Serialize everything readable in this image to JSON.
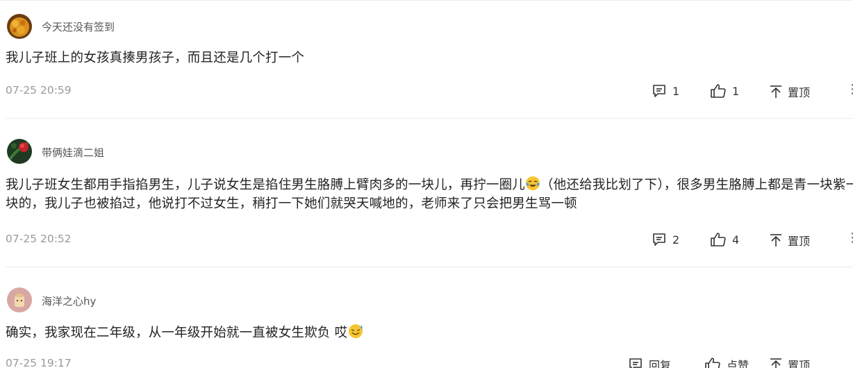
{
  "comments": [
    {
      "username": "今天还没有签到",
      "text": "我儿子班上的女孩真揍男孩子，而且还是几个打一个",
      "timestamp": "07-25 20:59",
      "reply_count": "1",
      "like_count": "1",
      "pin_label": "置顶",
      "avatar_icon": "food-avatar-icon"
    },
    {
      "username": "带俩娃滴二姐",
      "text_part1": "我儿子班女生都用手指掐男生，儿子说女生是掐住男生胳膊上臂肉多的一块儿，再拧一圈儿",
      "text_part2": "（他还给我比划了下），很多男生胳膊上都是青一块紫一块的，我儿子也被掐过，他说打不过女生，稍打一下她们就哭天喊地的，老师来了只会把男生骂一顿",
      "timestamp": "07-25 20:52",
      "reply_count": "2",
      "like_count": "4",
      "pin_label": "置顶",
      "avatar_icon": "flower-avatar-icon",
      "emoji_icon": "laugh-cry-emoji"
    },
    {
      "username": "海洋之心hy",
      "text": "确实，我家现在二年级，从一年级开始就一直被女生欺负 哎",
      "timestamp": "07-25 19:17",
      "reply_label": "回复",
      "like_label": "点赞",
      "pin_label": "置顶",
      "avatar_icon": "cartoon-avatar-icon",
      "emoji_icon": "sweat-smile-emoji"
    }
  ],
  "colors": {
    "text": "#222222",
    "muted": "#9a9a9a",
    "divider": "#ececec"
  }
}
